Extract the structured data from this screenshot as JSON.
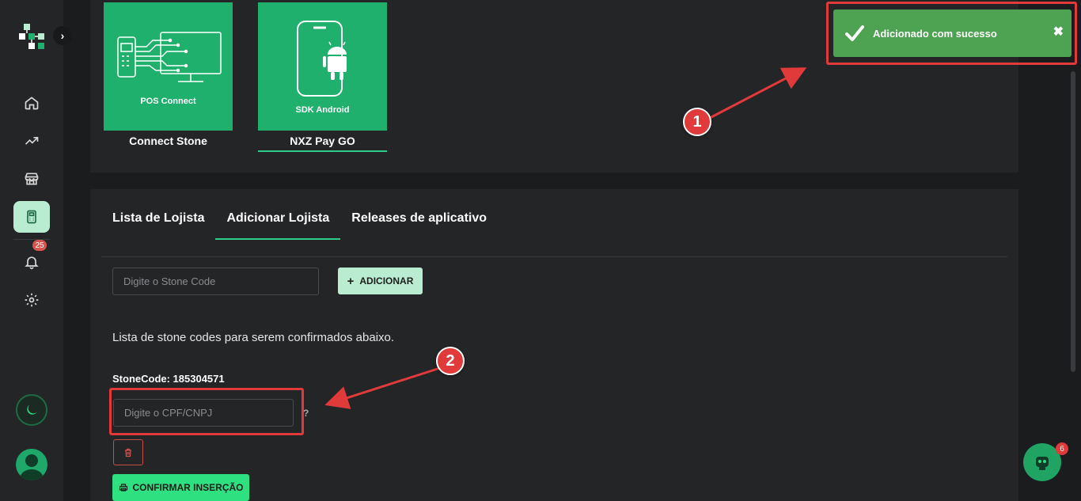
{
  "sidebar": {
    "notification_count": "25",
    "items": [
      {
        "name": "home"
      },
      {
        "name": "trending"
      },
      {
        "name": "store"
      },
      {
        "name": "pos",
        "active": true
      },
      {
        "name": "notifications"
      },
      {
        "name": "settings"
      }
    ]
  },
  "apps": [
    {
      "name": "Connect Stone",
      "tile_label": "POS Connect",
      "selected": false
    },
    {
      "name": "NXZ Pay GO",
      "tile_label": "SDK Android",
      "selected": true
    }
  ],
  "tabs": [
    {
      "label": "Lista de Lojista",
      "active": false
    },
    {
      "label": "Adicionar Lojista",
      "active": true
    },
    {
      "label": "Releases de aplicativo",
      "active": false
    }
  ],
  "form": {
    "stone_code_placeholder": "Digite o Stone Code",
    "add_button_label": "ADICIONAR",
    "list_text": "Lista de stone codes para serem confirmados abaixo.",
    "stonecode_label": "StoneCode: 185304571",
    "cpf_placeholder": "Digite o CPF/CNPJ",
    "help_mark": "?",
    "confirm_button_label": "CONFIRMAR INSERÇÃO"
  },
  "toast": {
    "message": "Adicionado com sucesso",
    "close_glyph": "✖"
  },
  "callouts": {
    "first": "1",
    "second": "2"
  },
  "chat": {
    "badge_count": "6"
  },
  "colors": {
    "accent": "#2ecc8a",
    "tile_green": "#1fb06d",
    "toast_green": "#4ea352",
    "annotation_red": "#e03a3a"
  }
}
